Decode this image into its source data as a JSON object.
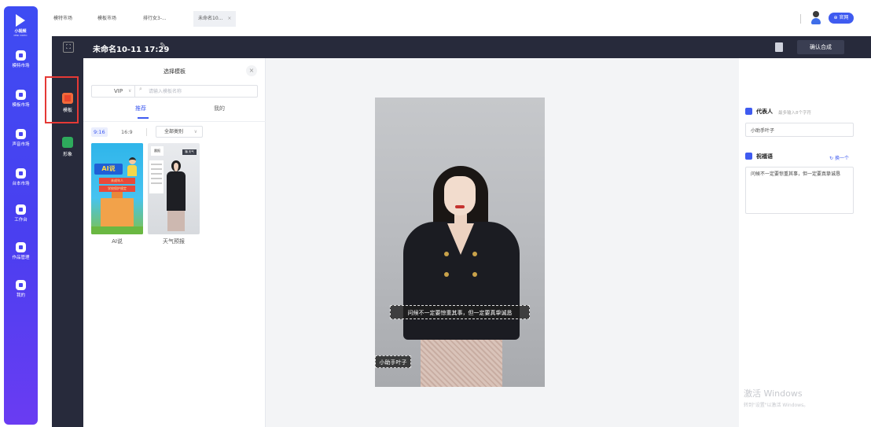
{
  "rail": {
    "logo_title": "小视频",
    "logo_sub": "MINI VIDEO",
    "items": [
      {
        "label": "模特市场"
      },
      {
        "label": "模板市场"
      },
      {
        "label": "声音市场"
      },
      {
        "label": "台本市场"
      },
      {
        "label": "工作台"
      },
      {
        "label": "作品管理"
      },
      {
        "label": "我的"
      }
    ]
  },
  "tabs": [
    {
      "label": "模特市场"
    },
    {
      "label": "模板市场"
    },
    {
      "label": "排行女3-..."
    },
    {
      "label": "未命名10...",
      "close": "×"
    }
  ],
  "topbar": {
    "official_label": "官网"
  },
  "editor": {
    "expand_glyph": "⛶",
    "title": "未命名10-11 17:29",
    "confirm_label": "确认合成"
  },
  "tools": [
    {
      "label": "模板"
    },
    {
      "label": "形象"
    }
  ],
  "picker": {
    "title": "选择模板",
    "close": "×",
    "vip_label": "VIP",
    "search_placeholder": "请输入模板名称",
    "tab_recommend": "推荐",
    "tab_mine": "我的",
    "ratio_916": "9:16",
    "ratio_169": "16:9",
    "category": "全部类别",
    "templates": [
      {
        "name": "AI说",
        "banner": "AI说",
        "line1": "未成年人",
        "line2": "学校保护规定"
      },
      {
        "name": "天气预报",
        "box_left": "晨报",
        "box_right": "播 天气"
      }
    ]
  },
  "canvas": {
    "caption": "问候不一定要惊重其事，但一定要真挚诚恳",
    "name_tag": "小助手叶子"
  },
  "props": {
    "rep_title": "代表人",
    "rep_hint": "最多输入8个字符",
    "rep_value": "小助手叶子",
    "bless_title": "祝福语",
    "swap_label": "换一个",
    "bless_value": "问候不一定要惊重其事，但一定要真挚诚恳"
  },
  "watermark": {
    "line1": "激活 Windows",
    "line2": "转到\"设置\"以激活 Windows。"
  },
  "colors": {
    "accent": "#3f5bf0",
    "dark_bg": "#272a3b",
    "highlight": "#e53935"
  }
}
